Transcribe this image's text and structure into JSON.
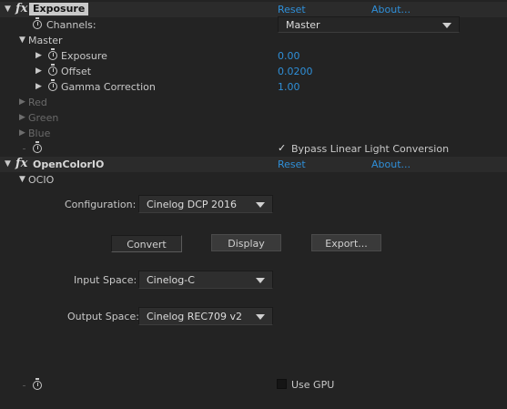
{
  "exposure": {
    "fx_label": "fx",
    "title": "Exposure",
    "reset": "Reset",
    "about": "About...",
    "channels_label": "Channels:",
    "channels_value": "Master",
    "master_group": "Master",
    "params": [
      {
        "label": "Exposure",
        "value": "0.00"
      },
      {
        "label": "Offset",
        "value": "0.0200"
      },
      {
        "label": "Gamma Correction",
        "value": "1.00"
      }
    ],
    "disabled_groups": [
      "Red",
      "Green",
      "Blue"
    ],
    "bypass_label": "Bypass Linear Light Conversion",
    "bypass_checked": "✓"
  },
  "ocio": {
    "fx_label": "fx",
    "title": "OpenColorIO",
    "reset": "Reset",
    "about": "About...",
    "group": "OCIO",
    "configuration_label": "Configuration:",
    "configuration_value": "Cinelog DCP 2016",
    "buttons": {
      "convert": "Convert",
      "display": "Display",
      "export": "Export..."
    },
    "input_space_label": "Input Space:",
    "input_space_value": "Cinelog-C",
    "output_space_label": "Output Space:",
    "output_space_value": "Cinelog REC709 v2",
    "gpu_label": "Use GPU"
  },
  "colors": {
    "accent_link": "#2f8fd8",
    "background": "#232323",
    "header_row": "#2b2b2b"
  },
  "icons": {
    "expand": "triangle-right",
    "collapse": "triangle-down",
    "stopwatch": "stopwatch-icon"
  }
}
